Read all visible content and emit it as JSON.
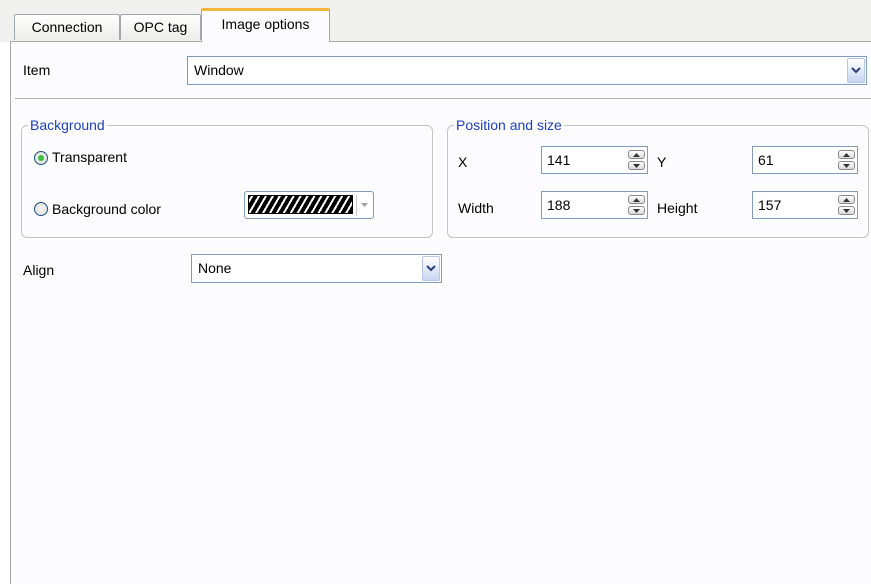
{
  "tabs": [
    {
      "label": "Connection"
    },
    {
      "label": "OPC tag"
    },
    {
      "label": "Image options",
      "active": true
    }
  ],
  "item": {
    "label": "Item",
    "value": "Window"
  },
  "background": {
    "title": "Background",
    "transparent_label": "Transparent",
    "color_label": "Background color",
    "selected": "Transparent"
  },
  "position": {
    "title": "Position and size",
    "x_label": "X",
    "x_value": "141",
    "y_label": "Y",
    "y_value": "61",
    "width_label": "Width",
    "width_value": "188",
    "height_label": "Height",
    "height_value": "157"
  },
  "align": {
    "label": "Align",
    "value": "None"
  },
  "colors": {
    "accent_tab": "#f4b53a",
    "group_title": "#1c3fc4",
    "radio_selected": "#3cbf3c"
  }
}
